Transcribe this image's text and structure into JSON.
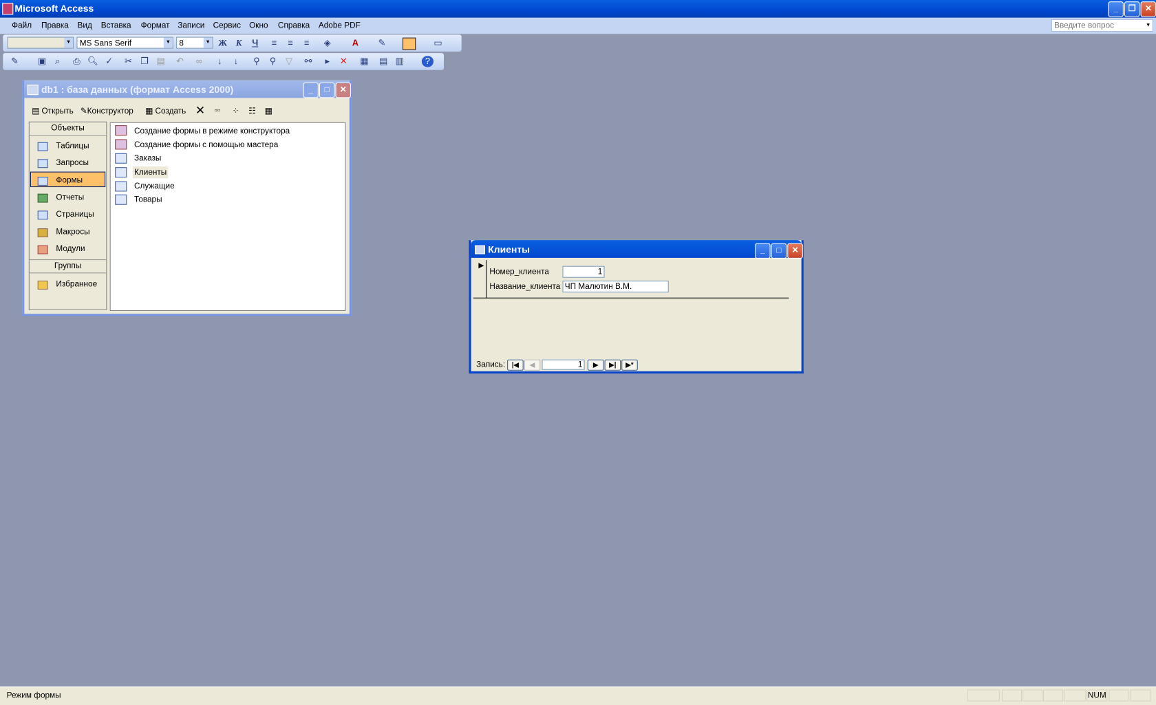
{
  "app": {
    "title": "Microsoft Access",
    "ask_placeholder": "Введите вопрос"
  },
  "menu": [
    "Файл",
    "Правка",
    "Вид",
    "Вставка",
    "Формат",
    "Записи",
    "Сервис",
    "Окно",
    "Справка",
    "Adobe PDF"
  ],
  "format_toolbar": {
    "font": "MS Sans Serif",
    "size": "8",
    "bold": "Ж",
    "italic": "К",
    "underline": "Ч"
  },
  "db_window": {
    "title": "db1 : база данных (формат Access 2000)",
    "open": "Открыть",
    "design": "Конструктор",
    "create": "Создать",
    "objects_header": "Объекты",
    "objects": [
      "Таблицы",
      "Запросы",
      "Формы",
      "Отчеты",
      "Страницы",
      "Макросы",
      "Модули"
    ],
    "groups_header": "Группы",
    "groups": [
      "Избранное"
    ],
    "items": [
      "Создание формы в режиме конструктора",
      "Создание формы с помощью мастера",
      "Заказы",
      "Клиенты",
      "Служащие",
      "Товары"
    ]
  },
  "form_window": {
    "title": "Клиенты",
    "field1_label": "Номер_клиента",
    "field1_value": "1",
    "field2_label": "Название_клиента",
    "field2_value": "ЧП Малютин В.М.",
    "record_label": "Запись:",
    "record_number": "1"
  },
  "status": {
    "text": "Режим формы",
    "num": "NUM"
  },
  "colors": {
    "selected": "#ffc06a",
    "desktop": "#8f97ae"
  }
}
